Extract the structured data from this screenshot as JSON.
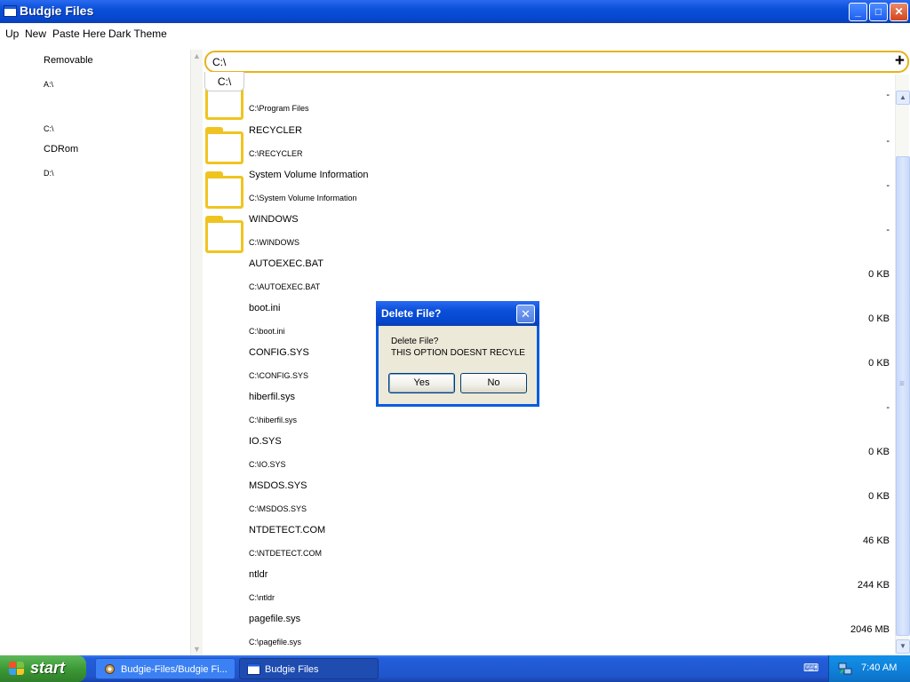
{
  "window": {
    "title": "Budgie Files",
    "controls": {
      "minimize": "_",
      "maximize": "□",
      "close": "✕"
    }
  },
  "menu": [
    "Up",
    "New",
    "Paste Here",
    "Dark Theme"
  ],
  "sidebar": {
    "items": [
      {
        "label": "Removable",
        "path": "A:\\"
      },
      {
        "label": "",
        "path": "C:\\"
      },
      {
        "label": "CDRom",
        "path": "D:\\"
      }
    ]
  },
  "address": {
    "value": "C:\\",
    "add_icon": "+",
    "breadcrumb": "C:\\"
  },
  "files": [
    {
      "name": "",
      "path": "C:\\Program Files",
      "size": "-",
      "folder": true
    },
    {
      "name": "RECYCLER",
      "path": "C:\\RECYCLER",
      "size": "-",
      "folder": true
    },
    {
      "name": "System Volume Information",
      "path": "C:\\System Volume Information",
      "size": "-",
      "folder": true
    },
    {
      "name": "WINDOWS",
      "path": "C:\\WINDOWS",
      "size": "-",
      "folder": true
    },
    {
      "name": "AUTOEXEC.BAT",
      "path": "C:\\AUTOEXEC.BAT",
      "size": "0 KB",
      "folder": false
    },
    {
      "name": "boot.ini",
      "path": "C:\\boot.ini",
      "size": "0 KB",
      "folder": false
    },
    {
      "name": "CONFIG.SYS",
      "path": "C:\\CONFIG.SYS",
      "size": "0 KB",
      "folder": false
    },
    {
      "name": "hiberfil.sys",
      "path": "C:\\hiberfil.sys",
      "size": "-",
      "folder": false
    },
    {
      "name": "IO.SYS",
      "path": "C:\\IO.SYS",
      "size": "0 KB",
      "folder": false
    },
    {
      "name": "MSDOS.SYS",
      "path": "C:\\MSDOS.SYS",
      "size": "0 KB",
      "folder": false
    },
    {
      "name": "NTDETECT.COM",
      "path": "C:\\NTDETECT.COM",
      "size": "46 KB",
      "folder": false
    },
    {
      "name": "ntldr",
      "path": "C:\\ntldr",
      "size": "244 KB",
      "folder": false
    },
    {
      "name": "pagefile.sys",
      "path": "C:\\pagefile.sys",
      "size": "2046 MB",
      "folder": false
    }
  ],
  "dialog": {
    "title": "Delete File?",
    "close": "✕",
    "message_line1": "Delete File?",
    "message_line2": "THIS OPTION DOESNT RECYLE",
    "yes": "Yes",
    "no": "No"
  },
  "taskbar": {
    "start": "start",
    "tasks": [
      "Budgie-Files/Budgie Fi...",
      "Budgie Files"
    ],
    "clock": "7:40 AM"
  },
  "colors": {
    "accent": "#e8b21a",
    "folder": "#f0c420",
    "titlebar": "#0a4fd8"
  }
}
